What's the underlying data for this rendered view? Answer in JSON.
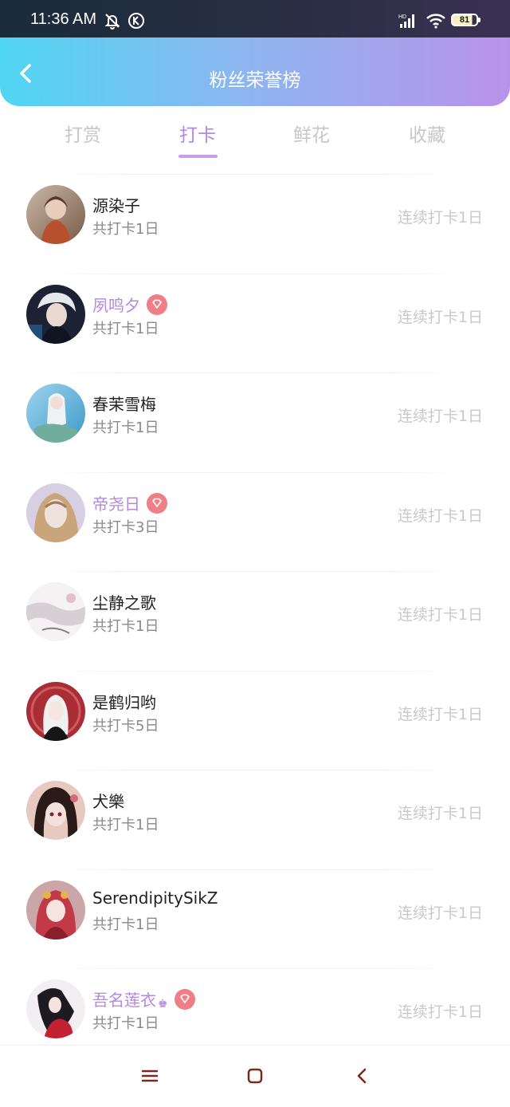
{
  "status_bar": {
    "time": "11:36 AM",
    "battery": "81",
    "icons": [
      "mute-bell-icon",
      "k-icon",
      "hd-signal-icon",
      "wifi-icon",
      "battery-icon"
    ]
  },
  "header": {
    "title": "粉丝荣誉榜",
    "back_icon": "back-arrow-icon"
  },
  "tabs": [
    {
      "label": "打赏",
      "active": false
    },
    {
      "label": "打卡",
      "active": true
    },
    {
      "label": "鲜花",
      "active": false
    },
    {
      "label": "收藏",
      "active": false
    }
  ],
  "colors": {
    "accent": "#b487e0",
    "header_start": "#4fd6f2",
    "header_end": "#b993ea",
    "badge": "#f07e86"
  },
  "fans": [
    {
      "name": "源染子",
      "total": "共打卡1日",
      "streak": "连续打卡1日",
      "vip": false,
      "crown": false
    },
    {
      "name": "夙鸣夕",
      "total": "共打卡1日",
      "streak": "连续打卡1日",
      "vip": true,
      "crown": false
    },
    {
      "name": "春茉雪梅",
      "total": "共打卡1日",
      "streak": "连续打卡1日",
      "vip": false,
      "crown": false
    },
    {
      "name": "帝尧日",
      "total": "共打卡3日",
      "streak": "连续打卡1日",
      "vip": true,
      "crown": false
    },
    {
      "name": "尘静之歌",
      "total": "共打卡1日",
      "streak": "连续打卡1日",
      "vip": false,
      "crown": false
    },
    {
      "name": "是鹤归哟",
      "total": "共打卡5日",
      "streak": "连续打卡1日",
      "vip": false,
      "crown": false
    },
    {
      "name": "犬樂",
      "total": "共打卡1日",
      "streak": "连续打卡1日",
      "vip": false,
      "crown": false
    },
    {
      "name": "SerendipitySikZ",
      "total": "共打卡1日",
      "streak": "连续打卡1日",
      "vip": false,
      "crown": false
    },
    {
      "name": "吾名莲衣",
      "total": "共打卡1日",
      "streak": "连续打卡1日",
      "vip": true,
      "crown": true
    }
  ],
  "nav": [
    "menu-icon",
    "home-square-icon",
    "back-chevron-icon"
  ]
}
